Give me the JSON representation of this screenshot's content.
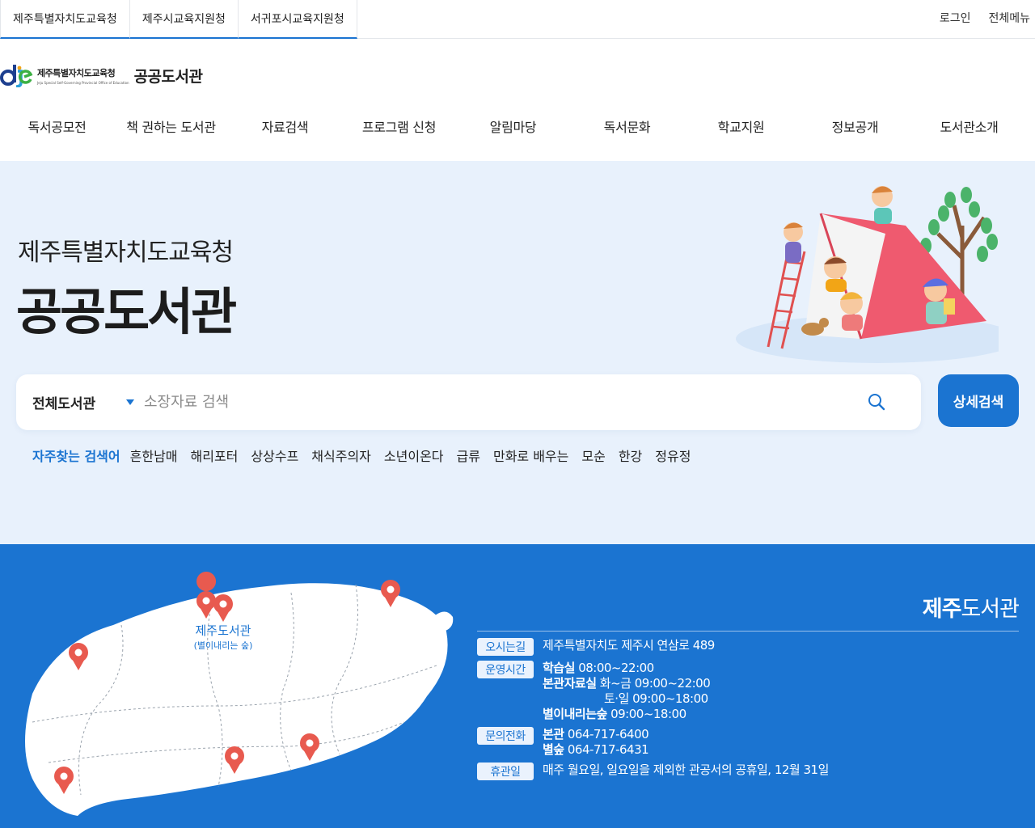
{
  "topbar": {
    "tabs": [
      "제주특별자치도교육청",
      "제주시교육지원청",
      "서귀포시교육지원청"
    ],
    "login": "로그인",
    "all_menu": "전체메뉴"
  },
  "logo": {
    "office": "제주특별자치도교육청",
    "office_en": "Jeju Special Self-Governing Provincial Office of Education",
    "name": "공공도서관"
  },
  "gnb": [
    "독서공모전",
    "책 권하는 도서관",
    "자료검색",
    "프로그램 신청",
    "알림마당",
    "독서문화",
    "학교지원",
    "정보공개",
    "도서관소개"
  ],
  "hero": {
    "subtitle": "제주특별자치도교육청",
    "title": "공공도서관"
  },
  "search": {
    "scope": "전체도서관",
    "placeholder": "소장자료 검색",
    "detail_button": "상세검색"
  },
  "keywords": {
    "label": "자주찾는 검색어",
    "items": [
      "흔한남매",
      "해리포터",
      "상상수프",
      "채식주의자",
      "소년이온다",
      "급류",
      "만화로 배우는",
      "모순",
      "한강",
      "정유정"
    ]
  },
  "map": {
    "label": "제주도서관",
    "sublabel": "(별이내리는 숲)"
  },
  "library": {
    "title_bold": "제주",
    "title_rest": "도서관",
    "address_tag": "오시는길",
    "address": "제주특별자치도 제주시 연삼로 489",
    "hours_tag": "운영시간",
    "hours_study_label": "학습실",
    "hours_study": "08:00~22:00",
    "hours_main_label": "본관자료실",
    "hours_main_weekday": "화~금 09:00~22:00",
    "hours_main_weekend": "토·일 09:00~18:00",
    "hours_forest_label": "별이내리는숲",
    "hours_forest": "09:00~18:00",
    "phone_tag": "문의전화",
    "phone_main_label": "본관",
    "phone_main": "064-717-6400",
    "phone_forest_label": "별숲",
    "phone_forest": "064-717-6431",
    "closed_tag": "휴관일",
    "closed": "매주 월요일, 일요일을 제외한 관공서의 공휴일, 12월 31일"
  }
}
